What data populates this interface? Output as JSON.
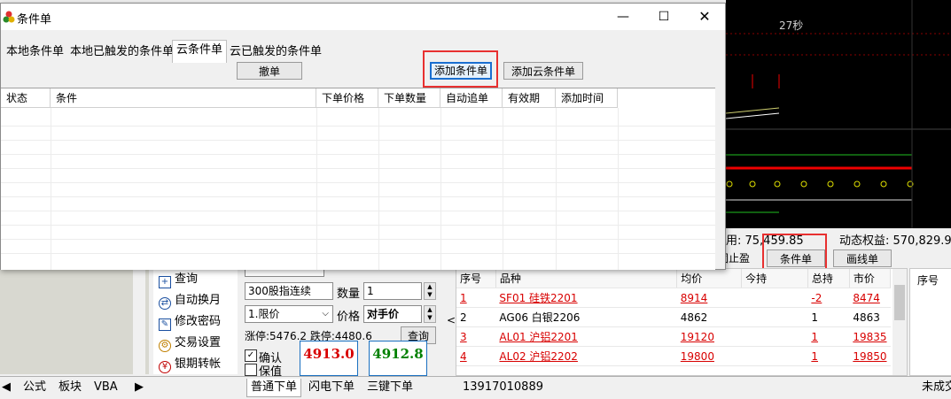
{
  "chart": {
    "timer": "27秒"
  },
  "status_strip": {
    "margin_text": "用: 75,459.85",
    "equity_text": "动态权益: 570,829.92"
  },
  "buttons_row": {
    "stop": "固止盈",
    "conditional": "条件单",
    "draw_line": "画线单"
  },
  "dialog": {
    "title": "条件单",
    "tabs": [
      "本地条件单",
      "本地已触发的条件单",
      "云条件单",
      "云已触发的条件单"
    ],
    "cancel_button": "撤单",
    "add_button": "添加条件单",
    "add_cloud_button": "添加云条件单",
    "columns": [
      "状态",
      "条件",
      "下单价格",
      "下单数量",
      "自动追单",
      "有效期",
      "添加时间"
    ]
  },
  "left_menu": {
    "items": [
      {
        "label": "查询",
        "icon": "plus-box-icon"
      },
      {
        "label": "自动换月",
        "icon": "swap-icon"
      },
      {
        "label": "修改密码",
        "icon": "edit-icon"
      },
      {
        "label": "交易设置",
        "icon": "gear-icon"
      },
      {
        "label": "银期转帐",
        "icon": "yen-icon"
      }
    ]
  },
  "entry": {
    "contract": "300股指连续",
    "qty_label": "数量",
    "qty_value": "1",
    "order_type": "1.限价",
    "price_label": "价格",
    "price_value": "对手价",
    "limits": "涨停:5476.2 跌停:4480.6",
    "query_button": "查询",
    "confirm_label": "确认",
    "keep_label": "保值",
    "buy_price": "4913.0",
    "sell_price": "4912.8"
  },
  "orders": {
    "columns": [
      "序号",
      "品种",
      "均价",
      "今持",
      "总持",
      "市价"
    ],
    "rows": [
      {
        "no": "1",
        "name": "SF01 硅铁2201",
        "avg": "8914",
        "today": "",
        "total": "-2",
        "mkt": "8474",
        "red": true
      },
      {
        "no": "2",
        "name": "AG06 白银2206",
        "avg": "4862",
        "today": "",
        "total": "1",
        "mkt": "4863",
        "red": false
      },
      {
        "no": "3",
        "name": "AL01 沪铝2201",
        "avg": "19120",
        "today": "",
        "total": "1",
        "mkt": "19835",
        "red": true
      },
      {
        "no": "4",
        "name": "AL02 沪铝2202",
        "avg": "19800",
        "today": "",
        "total": "1",
        "mkt": "19850",
        "red": true
      }
    ]
  },
  "far_right": {
    "header": "序号"
  },
  "bottom": {
    "left_tabs": [
      "公式",
      "板块",
      "VBA"
    ],
    "entry_tabs": [
      "普通下单",
      "闪电下单",
      "三键下单"
    ],
    "account": "13917010889",
    "right_tab": "未成交"
  },
  "colors": {
    "accent_red": "#e83030",
    "buy_red": "#d80000",
    "sell_green": "#008000"
  }
}
